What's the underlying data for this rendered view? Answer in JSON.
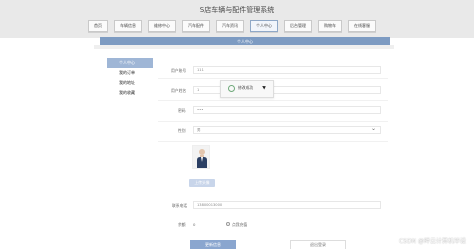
{
  "app": {
    "title": "S店车辆与配件管理系统"
  },
  "nav": {
    "items": [
      {
        "label": "首页",
        "width": 20
      },
      {
        "label": "车辆信息",
        "width": 28
      },
      {
        "label": "维修中心",
        "width": 28
      },
      {
        "label": "汽车配件",
        "width": 28
      },
      {
        "label": "汽车资讯",
        "width": 28
      },
      {
        "label": "个人中心",
        "width": 28,
        "active": true
      },
      {
        "label": "后台管理",
        "width": 28
      },
      {
        "label": "购物车",
        "width": 24
      },
      {
        "label": "在线客服",
        "width": 28
      }
    ]
  },
  "header": {
    "section_title": "个人中心"
  },
  "sidebar": {
    "items": [
      {
        "label": "个人中心",
        "active": true
      },
      {
        "label": "我的订单"
      },
      {
        "label": "我的地址"
      },
      {
        "label": "我的收藏"
      }
    ]
  },
  "form": {
    "username_label": "用户账号",
    "username_value": "111",
    "name_label": "用户姓名",
    "name_value": "1",
    "password_label": "密码",
    "password_value": "•••",
    "gender_label": "性别",
    "gender_value": "男",
    "upload_button": "上传头像",
    "phone_label": "联系电话",
    "phone_value": "13800013000",
    "balance_label": "余额",
    "balance_value": "0",
    "recharge_link": "点我充值",
    "update_button": "更新信息",
    "logout_button": "退出登录"
  },
  "popup": {
    "message": "修改成功"
  },
  "watermark": "CSDN @畔云计算机毕设"
}
